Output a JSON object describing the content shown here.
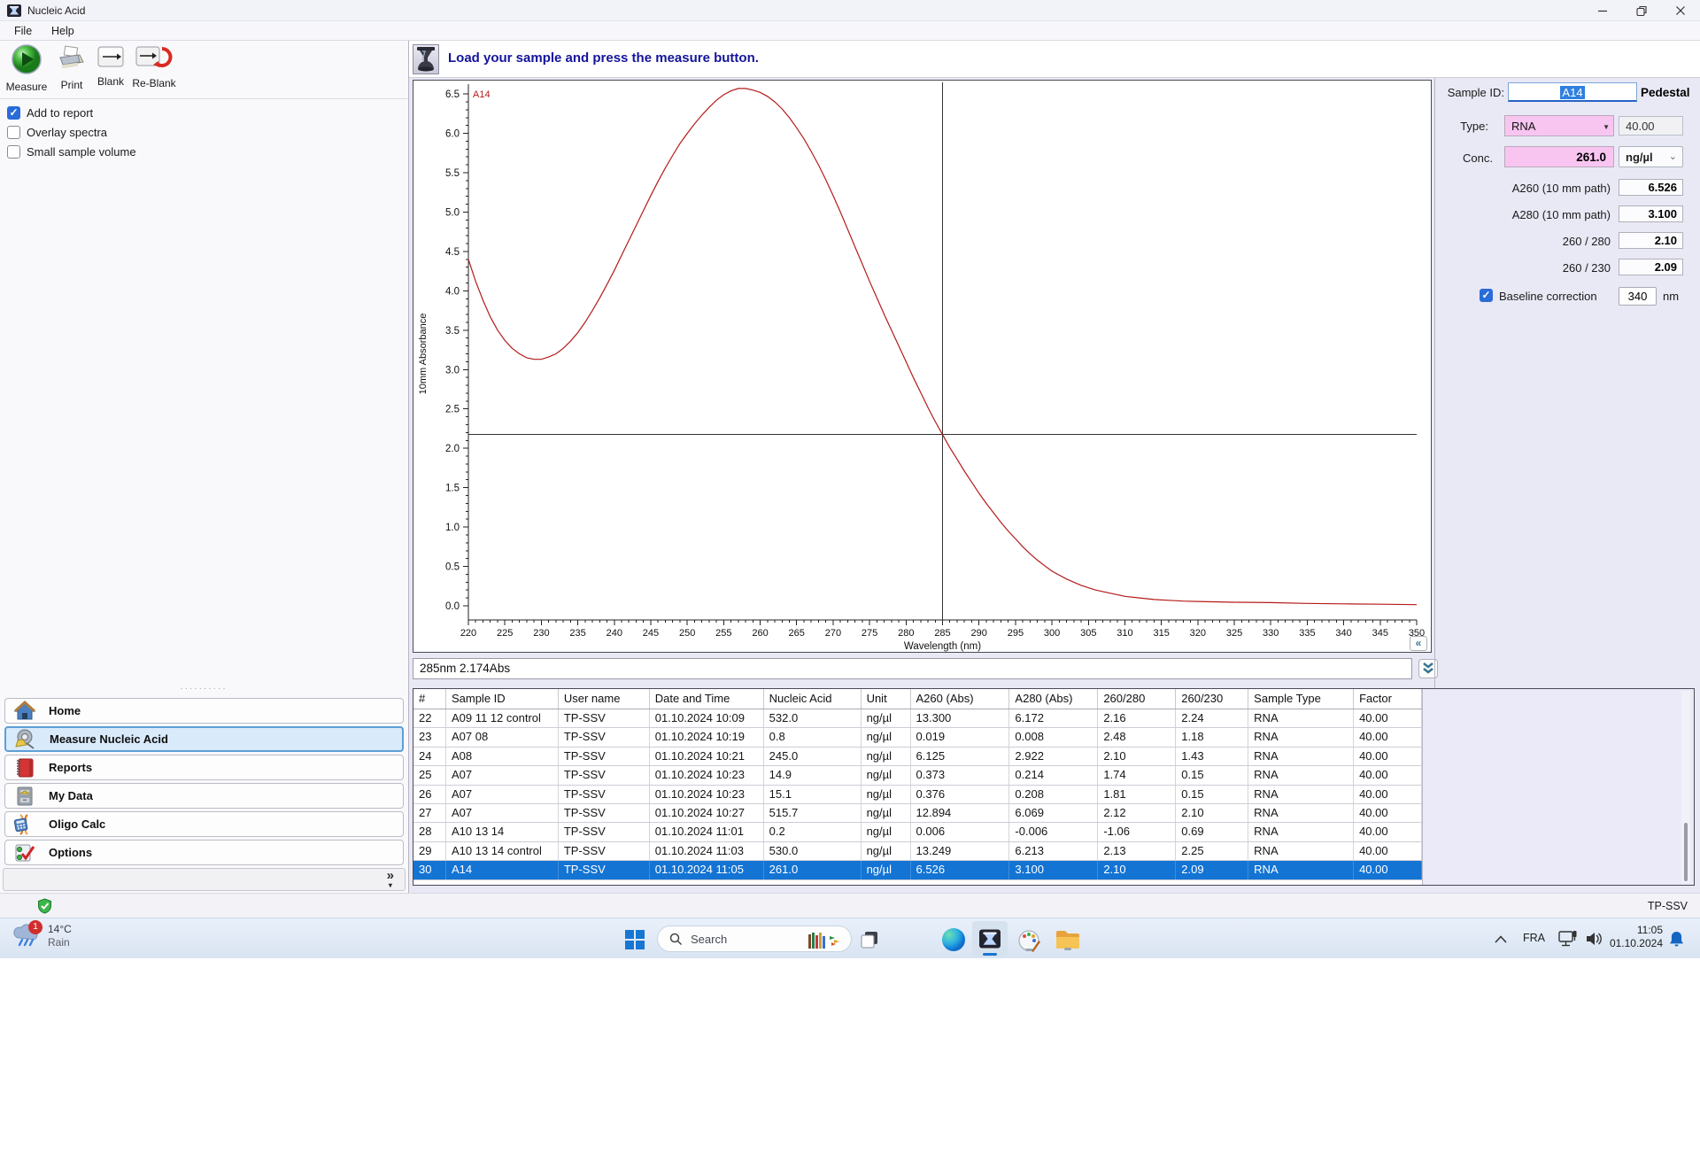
{
  "window": {
    "title": "Nucleic Acid"
  },
  "menu": {
    "items": [
      "File",
      "Help"
    ]
  },
  "toolbar": {
    "buttons": [
      {
        "label": "Measure"
      },
      {
        "label": "Print"
      },
      {
        "label": "Blank"
      },
      {
        "label": "Re-Blank"
      }
    ]
  },
  "left_options": [
    {
      "label": "Add to report",
      "checked": true
    },
    {
      "label": "Overlay spectra",
      "checked": false
    },
    {
      "label": "Small sample volume",
      "checked": false
    }
  ],
  "message": {
    "text": "Load your sample and press the measure button."
  },
  "sidebar": {
    "items": [
      {
        "label": "Home"
      },
      {
        "label": "Measure Nucleic Acid",
        "selected": true
      },
      {
        "label": "Reports"
      },
      {
        "label": "My Data"
      },
      {
        "label": "Oligo Calc"
      },
      {
        "label": "Options"
      }
    ]
  },
  "readout": {
    "text": "285nm 2.174Abs"
  },
  "chart_data": {
    "type": "line",
    "series_label": "A14",
    "color": "#b51a1a",
    "xlabel": "Wavelength (nm)",
    "ylabel": "10mm Absorbance",
    "xlim": [
      220,
      350
    ],
    "ylim": [
      0,
      6.5
    ],
    "x_tick_step": 5,
    "y_tick_step": 0.5,
    "x_minor_step": 1,
    "y_minor_step": 0.1,
    "legend_position": "top-left",
    "grid": false,
    "cursor": {
      "wavelength": 285,
      "absorbance": 2.174
    },
    "points": [
      [
        220,
        4.4
      ],
      [
        221,
        4.12
      ],
      [
        222,
        3.88
      ],
      [
        223,
        3.67
      ],
      [
        224,
        3.5
      ],
      [
        225,
        3.37
      ],
      [
        226,
        3.27
      ],
      [
        227,
        3.2
      ],
      [
        228,
        3.15
      ],
      [
        229,
        3.13
      ],
      [
        230,
        3.13
      ],
      [
        231,
        3.16
      ],
      [
        232,
        3.2
      ],
      [
        233,
        3.27
      ],
      [
        234,
        3.36
      ],
      [
        235,
        3.47
      ],
      [
        236,
        3.6
      ],
      [
        237,
        3.75
      ],
      [
        238,
        3.91
      ],
      [
        239,
        4.08
      ],
      [
        240,
        4.26
      ],
      [
        241,
        4.45
      ],
      [
        242,
        4.64
      ],
      [
        243,
        4.83
      ],
      [
        244,
        5.02
      ],
      [
        245,
        5.21
      ],
      [
        246,
        5.39
      ],
      [
        247,
        5.56
      ],
      [
        248,
        5.72
      ],
      [
        249,
        5.87
      ],
      [
        250,
        6.0
      ],
      [
        251,
        6.12
      ],
      [
        252,
        6.23
      ],
      [
        253,
        6.33
      ],
      [
        254,
        6.42
      ],
      [
        255,
        6.49
      ],
      [
        256,
        6.54
      ],
      [
        257,
        6.57
      ],
      [
        258,
        6.57
      ],
      [
        259,
        6.55
      ],
      [
        260,
        6.52
      ],
      [
        261,
        6.47
      ],
      [
        262,
        6.4
      ],
      [
        263,
        6.31
      ],
      [
        264,
        6.2
      ],
      [
        265,
        6.07
      ],
      [
        266,
        5.93
      ],
      [
        267,
        5.77
      ],
      [
        268,
        5.6
      ],
      [
        269,
        5.41
      ],
      [
        270,
        5.21
      ],
      [
        271,
        5.0
      ],
      [
        272,
        4.78
      ],
      [
        273,
        4.56
      ],
      [
        274,
        4.34
      ],
      [
        275,
        4.12
      ],
      [
        276,
        3.91
      ],
      [
        277,
        3.7
      ],
      [
        278,
        3.5
      ],
      [
        279,
        3.3
      ],
      [
        280,
        3.1
      ],
      [
        281,
        2.9
      ],
      [
        282,
        2.71
      ],
      [
        283,
        2.52
      ],
      [
        284,
        2.34
      ],
      [
        285,
        2.174
      ],
      [
        286,
        2.01
      ],
      [
        287,
        1.86
      ],
      [
        288,
        1.71
      ],
      [
        289,
        1.57
      ],
      [
        290,
        1.43
      ],
      [
        291,
        1.3
      ],
      [
        292,
        1.18
      ],
      [
        293,
        1.06
      ],
      [
        294,
        0.95
      ],
      [
        295,
        0.85
      ],
      [
        296,
        0.75
      ],
      [
        297,
        0.66
      ],
      [
        298,
        0.58
      ],
      [
        299,
        0.51
      ],
      [
        300,
        0.44
      ],
      [
        302,
        0.34
      ],
      [
        304,
        0.26
      ],
      [
        306,
        0.2
      ],
      [
        308,
        0.16
      ],
      [
        310,
        0.12
      ],
      [
        312,
        0.1
      ],
      [
        314,
        0.08
      ],
      [
        316,
        0.07
      ],
      [
        318,
        0.06
      ],
      [
        320,
        0.055
      ],
      [
        325,
        0.045
      ],
      [
        330,
        0.04
      ],
      [
        335,
        0.03
      ],
      [
        340,
        0.025
      ],
      [
        345,
        0.02
      ],
      [
        350,
        0.015
      ]
    ]
  },
  "sample_panel": {
    "sample_id_label": "Sample ID:",
    "sample_id_value": "A14",
    "mode": "Pedestal",
    "type_label": "Type:",
    "type_value": "RNA",
    "factor_value": "40.00",
    "conc_label": "Conc.",
    "conc_value": "261.0",
    "unit_value": "ng/µl",
    "rows": [
      {
        "label": "A260 (10 mm path)",
        "value": "6.526"
      },
      {
        "label": "A280 (10 mm path)",
        "value": "3.100"
      },
      {
        "label": "260 / 280",
        "value": "2.10"
      },
      {
        "label": "260 / 230",
        "value": "2.09"
      }
    ],
    "baseline": {
      "label": "Baseline correction",
      "checked": true,
      "value": "340",
      "unit": "nm"
    }
  },
  "table": {
    "columns": [
      "#",
      "Sample ID",
      "User name",
      "Date and Time",
      "Nucleic Acid",
      "Unit",
      "A260 (Abs)",
      "A280 (Abs)",
      "260/280",
      "260/230",
      "Sample Type",
      "Factor"
    ],
    "rows": [
      [
        "22",
        "A09 11 12 control",
        "TP-SSV",
        "01.10.2024 10:09",
        "532.0",
        "ng/µl",
        "13.300",
        "6.172",
        "2.16",
        "2.24",
        "RNA",
        "40.00"
      ],
      [
        "23",
        "A07 08",
        "TP-SSV",
        "01.10.2024 10:19",
        "0.8",
        "ng/µl",
        "0.019",
        "0.008",
        "2.48",
        "1.18",
        "RNA",
        "40.00"
      ],
      [
        "24",
        "A08",
        "TP-SSV",
        "01.10.2024 10:21",
        "245.0",
        "ng/µl",
        "6.125",
        "2.922",
        "2.10",
        "1.43",
        "RNA",
        "40.00"
      ],
      [
        "25",
        "A07",
        "TP-SSV",
        "01.10.2024 10:23",
        "14.9",
        "ng/µl",
        "0.373",
        "0.214",
        "1.74",
        "0.15",
        "RNA",
        "40.00"
      ],
      [
        "26",
        "A07",
        "TP-SSV",
        "01.10.2024 10:23",
        "15.1",
        "ng/µl",
        "0.376",
        "0.208",
        "1.81",
        "0.15",
        "RNA",
        "40.00"
      ],
      [
        "27",
        "A07",
        "TP-SSV",
        "01.10.2024 10:27",
        "515.7",
        "ng/µl",
        "12.894",
        "6.069",
        "2.12",
        "2.10",
        "RNA",
        "40.00"
      ],
      [
        "28",
        "A10 13 14",
        "TP-SSV",
        "01.10.2024 11:01",
        "0.2",
        "ng/µl",
        "0.006",
        "-0.006",
        "-1.06",
        "0.69",
        "RNA",
        "40.00"
      ],
      [
        "29",
        "A10 13 14 control",
        "TP-SSV",
        "01.10.2024 11:03",
        "530.0",
        "ng/µl",
        "13.249",
        "6.213",
        "2.13",
        "2.25",
        "RNA",
        "40.00"
      ],
      [
        "30",
        "A14",
        "TP-SSV",
        "01.10.2024 11:05",
        "261.0",
        "ng/µl",
        "6.526",
        "3.100",
        "2.10",
        "2.09",
        "RNA",
        "40.00"
      ]
    ],
    "selected_row_index": 8
  },
  "status_bar": {
    "user": "TP-SSV"
  },
  "taskbar": {
    "weather": {
      "temp": "14°C",
      "condition": "Rain",
      "badge": "1"
    },
    "search_placeholder": "Search",
    "tray": {
      "language": "FRA",
      "time": "11:05",
      "date": "01.10.2024"
    }
  }
}
